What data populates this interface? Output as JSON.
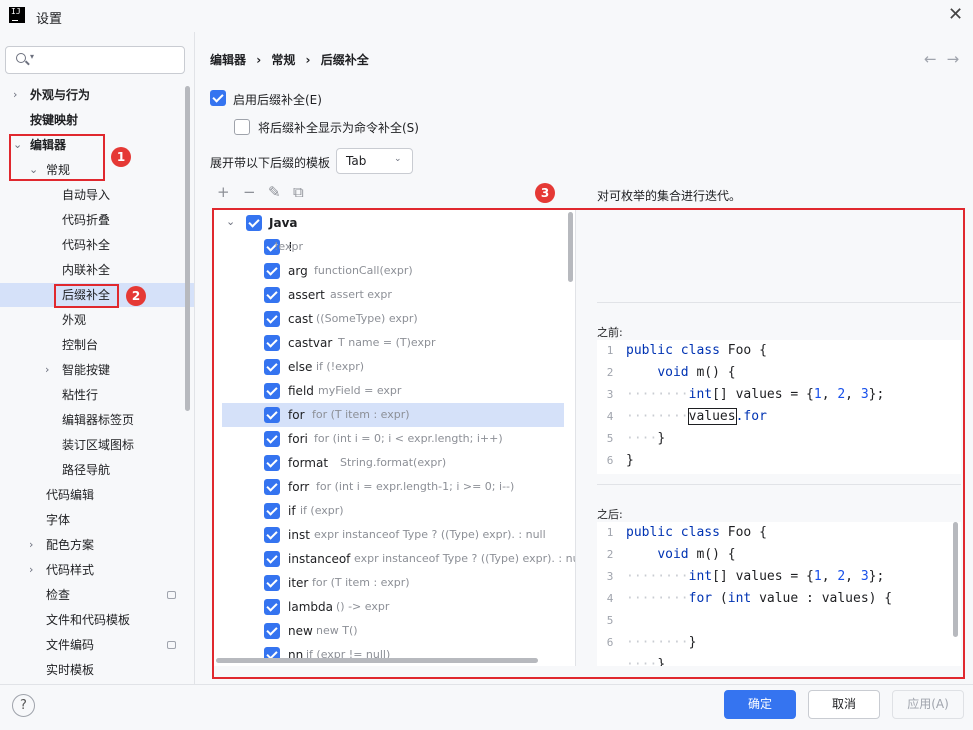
{
  "window": {
    "title": "设置",
    "close": "✕"
  },
  "search": {
    "placeholder": ""
  },
  "tree": [
    {
      "label": "外观与行为",
      "bold": true,
      "arrow": "›"
    },
    {
      "label": "按键映射",
      "bold": true,
      "arrow": ""
    },
    {
      "label": "编辑器",
      "bold": true,
      "arrow": "⌄"
    },
    {
      "label": "常规",
      "bold": false,
      "arrow": "⌄"
    },
    {
      "label": "自动导入",
      "bold": false,
      "arrow": ""
    },
    {
      "label": "代码折叠",
      "bold": false,
      "arrow": ""
    },
    {
      "label": "代码补全",
      "bold": false,
      "arrow": ""
    },
    {
      "label": "内联补全",
      "bold": false,
      "arrow": ""
    },
    {
      "label": "后缀补全",
      "bold": false,
      "arrow": "",
      "selected": true
    },
    {
      "label": "外观",
      "bold": false,
      "arrow": ""
    },
    {
      "label": "控制台",
      "bold": false,
      "arrow": ""
    },
    {
      "label": "智能按键",
      "bold": false,
      "arrow": "›"
    },
    {
      "label": "粘性行",
      "bold": false,
      "arrow": ""
    },
    {
      "label": "编辑器标签页",
      "bold": false,
      "arrow": ""
    },
    {
      "label": "装订区域图标",
      "bold": false,
      "arrow": ""
    },
    {
      "label": "路径导航",
      "bold": false,
      "arrow": ""
    },
    {
      "label": "代码编辑",
      "bold": false,
      "arrow": ""
    },
    {
      "label": "字体",
      "bold": false,
      "arrow": ""
    },
    {
      "label": "配色方案",
      "bold": false,
      "arrow": "›"
    },
    {
      "label": "代码样式",
      "bold": false,
      "arrow": "›"
    },
    {
      "label": "检查",
      "bold": false,
      "arrow": "",
      "badge": true
    },
    {
      "label": "文件和代码模板",
      "bold": false,
      "arrow": ""
    },
    {
      "label": "文件编码",
      "bold": false,
      "arrow": "",
      "badge": true
    },
    {
      "label": "实时模板",
      "bold": false,
      "arrow": ""
    }
  ],
  "annotations": {
    "one": "1",
    "two": "2",
    "three": "3"
  },
  "breadcrumb": [
    "编辑器",
    "常规",
    "后缀补全"
  ],
  "breadcrumb_sep": "›",
  "nav": {
    "back": "←",
    "forward": "→"
  },
  "options": {
    "enable_label": "启用后缀补全(E)",
    "enable_checked": true,
    "show_as_cmd_label": "将后缀补全显示为命令补全(S)",
    "show_as_cmd_checked": false,
    "expand_label": "展开带以下后缀的模板",
    "expand_value": "Tab"
  },
  "toolbar": {
    "add": "+",
    "remove": "−",
    "edit": "✎",
    "copy": "⧉"
  },
  "list": {
    "group": "Java",
    "items": [
      {
        "name": "!",
        "desc": "!expr"
      },
      {
        "name": "arg",
        "desc": "functionCall(expr)"
      },
      {
        "name": "assert",
        "desc": "assert expr"
      },
      {
        "name": "cast",
        "desc": "((SomeType) expr)"
      },
      {
        "name": "castvar",
        "desc": "T name = (T)expr"
      },
      {
        "name": "else",
        "desc": "if (!expr)"
      },
      {
        "name": "field",
        "desc": "myField = expr"
      },
      {
        "name": "for",
        "desc": "for (T item : expr)",
        "selected": true
      },
      {
        "name": "fori",
        "desc": "for (int i = 0; i < expr.length; i++)"
      },
      {
        "name": "format",
        "desc": "String.format(expr)"
      },
      {
        "name": "forr",
        "desc": "for (int i = expr.length-1; i >= 0; i--)"
      },
      {
        "name": "if",
        "desc": "if (expr)"
      },
      {
        "name": "inst",
        "desc": "expr instanceof Type ? ((Type) expr). : null"
      },
      {
        "name": "instanceof",
        "desc": "expr instanceof Type ? ((Type) expr). : null"
      },
      {
        "name": "iter",
        "desc": "for (T item : expr)"
      },
      {
        "name": "lambda",
        "desc": "() -> expr"
      },
      {
        "name": "new",
        "desc": "new T()"
      },
      {
        "name": "nn",
        "desc": "if (expr != null)"
      }
    ]
  },
  "description": "对可枚举的集合进行迭代。",
  "before": {
    "title": "之前:",
    "lines": [
      "1",
      "2",
      "3",
      "4",
      "5",
      "6"
    ]
  },
  "after": {
    "title": "之后:",
    "lines": [
      "1",
      "2",
      "3",
      "4",
      "5",
      "6"
    ]
  },
  "code_tokens": {
    "public": "public",
    "class": "class",
    "Foo": " Foo {",
    "void": "void",
    "m": " m() {",
    "int": "int",
    "arr": "[] values = {",
    "n1": "1",
    "n2": "2",
    "n3": "3",
    "end": "};",
    "values": "values",
    "dotfor": ".for",
    "close1": "}",
    "close2": "}",
    "for": "for",
    "forrest": " value : values) {",
    "paren": " (",
    "intkw": "int"
  },
  "buttons": {
    "help": "?",
    "ok": "确定",
    "cancel": "取消",
    "apply": "应用(A)"
  },
  "colors": {
    "accent": "#3574f0",
    "annotation": "#e0282e",
    "selection": "#d5e1f9"
  }
}
